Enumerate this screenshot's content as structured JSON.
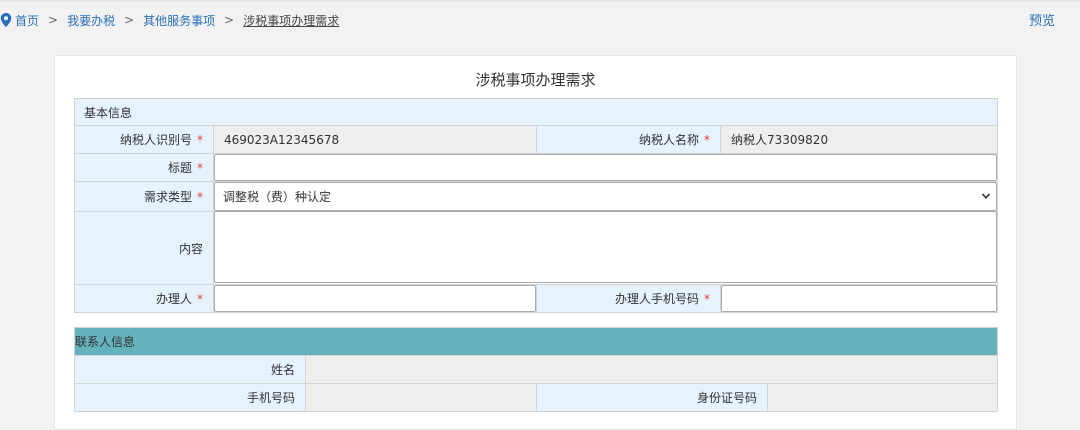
{
  "breadcrumb": {
    "items": [
      "首页",
      "我要办税",
      "其他服务事项",
      "涉税事项办理需求"
    ],
    "separator": ">"
  },
  "header": {
    "preview_label": "预览"
  },
  "form": {
    "title": "涉税事项办理需求",
    "basic_section": "基本信息",
    "taxpayer_id_label": "纳税人识别号",
    "taxpayer_id_value": "469023A12345678",
    "taxpayer_name_label": "纳税人名称",
    "taxpayer_name_value": "纳税人73309820",
    "subject_label": "标题",
    "subject_value": "",
    "demand_type_label": "需求类型",
    "demand_type_value": "调整税（费）种认定",
    "content_label": "内容",
    "content_value": "",
    "handler_label": "办理人",
    "handler_value": "",
    "handler_phone_label": "办理人手机号码",
    "handler_phone_value": "",
    "required_mark": "*"
  },
  "contact": {
    "section": "联系人信息",
    "name_label": "姓名",
    "phone_label": "手机号码",
    "id_card_label": "身份证号码"
  },
  "colors": {
    "link": "#2a6fb6",
    "label_bg": "#e6f2fd",
    "readonly_bg": "#eeeeee",
    "contact_header": "#64b2bd",
    "required": "#e53935"
  }
}
